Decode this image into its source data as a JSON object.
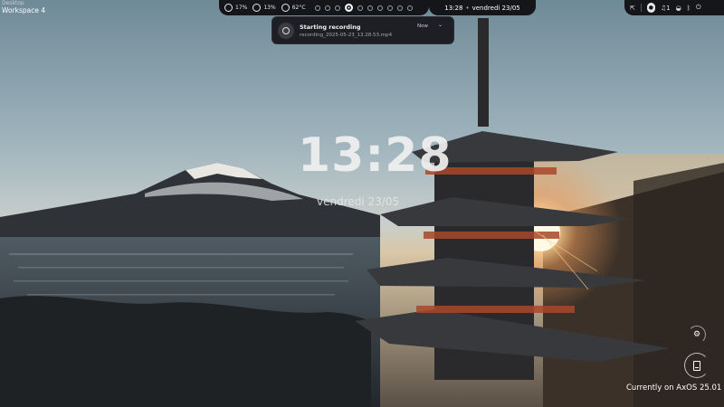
{
  "workspace": {
    "label": "Desktop",
    "name": "Workspace 4"
  },
  "topbar": {
    "stats": [
      {
        "icon": "cpu-ring-icon",
        "value": "17%"
      },
      {
        "icon": "memory-ring-icon",
        "value": "13%"
      },
      {
        "icon": "temperature-ring-icon",
        "value": "62°C"
      }
    ],
    "workspaces_count": 10,
    "active_workspace_index": 3,
    "time": "13:28",
    "date": "vendredi 23/05",
    "separator": "•",
    "tray_icons": [
      "network-icon",
      "microphone-icon",
      "notification-bell-icon",
      "wifi-icon",
      "bluetooth-icon",
      "power-icon"
    ],
    "notification_count": "1"
  },
  "notification": {
    "title": "Starting recording",
    "body": "recording_2025-05-23_13.28.53.mp4",
    "time": "Now",
    "expand_glyph": "⌄"
  },
  "desktop_clock": {
    "time": "13:28",
    "date": "vendredi 23/05"
  },
  "footer": {
    "os_label": "Currently on AxOS 25.01"
  }
}
